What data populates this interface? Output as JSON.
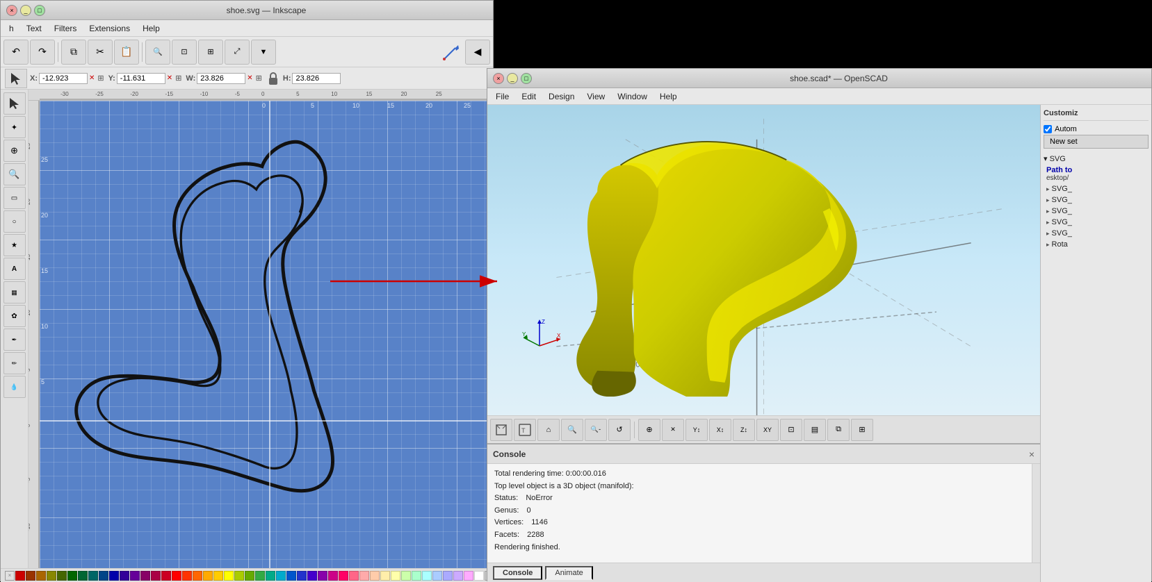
{
  "inkscape": {
    "title": "shoe.svg — Inkscape",
    "menubar": [
      "h",
      "Text",
      "Filters",
      "Extensions",
      "Help"
    ],
    "toolbar_buttons": [
      "undo",
      "redo",
      "copy",
      "cut",
      "paste",
      "zoom-in",
      "zoom-fit",
      "zoom-box",
      "dropdown"
    ],
    "coords": {
      "x_label": "X:",
      "x_value": "-12.923",
      "y_label": "Y:",
      "y_value": "-11.631",
      "w_label": "W:",
      "w_value": "23.826",
      "h_label": "H:",
      "h_value": "23.826"
    },
    "left_toolbar": [
      "select",
      "node",
      "tweak",
      "zoom",
      "rect",
      "circle",
      "star",
      "text",
      "gradient",
      "spray",
      "measure",
      "pen",
      "pencil",
      "bezier",
      "eyedropper"
    ],
    "canvas": {
      "ruler_marks": [
        "-30",
        "-25",
        "-20",
        "-15",
        "-10",
        "-5",
        "0",
        "5",
        "10",
        "15",
        "20",
        "25"
      ],
      "ruler_marks_vertical": [
        "25",
        "20",
        "15",
        "10",
        "5",
        "0",
        "-5",
        "-10"
      ]
    },
    "statusbar": {
      "text": ""
    },
    "colors": [
      "#cc0000",
      "#aa3300",
      "#aa6600",
      "#888800",
      "#446600",
      "#006600",
      "#006633",
      "#006666",
      "#004488",
      "#0000aa",
      "#330099",
      "#660099",
      "#880066",
      "#aa0044",
      "#cc0022",
      "#ff0000",
      "#ff3300",
      "#ff6600",
      "#ffaa00",
      "#ffcc00",
      "#ffff00",
      "#aacc00",
      "#66aa00",
      "#33aa44",
      "#00aa88",
      "#00aacc",
      "#0055cc",
      "#2233cc",
      "#4400cc",
      "#8800aa",
      "#cc0088",
      "#ff0066",
      "#ff6688",
      "#ffaaaa",
      "#ffccaa",
      "#ffeeaa",
      "#ffffaa",
      "#ccffaa",
      "#aaffcc",
      "#aaffff",
      "#aaccff",
      "#aaaaff",
      "#ccaaff",
      "#ffaaff",
      "#ffffff",
      "#cccccc",
      "#aaaaaa",
      "#888888",
      "#555555",
      "#222222",
      "#000000"
    ]
  },
  "openscad": {
    "title": "shoe.scad* — OpenSCAD",
    "menubar": [
      "File",
      "Edit",
      "Design",
      "View",
      "Window",
      "Help"
    ],
    "sidebar": {
      "customize_label": "Customiz",
      "automate_checkbox": "Autom",
      "new_set_button": "New set",
      "svg_section": "▾ SVG",
      "path_label": "Path to",
      "path_value": "esktop/",
      "tree_items": [
        {
          "arrow": "▸",
          "label": "SVG_"
        },
        {
          "arrow": "▸",
          "label": "SVG_"
        },
        {
          "arrow": "▸",
          "label": "SVG_"
        },
        {
          "arrow": "▸",
          "label": "SVG_"
        },
        {
          "arrow": "▸",
          "label": "SVG_"
        },
        {
          "arrow": "▸",
          "label": "Rota"
        }
      ]
    },
    "console": {
      "title": "Console",
      "close_btn": "×",
      "rendering_time": "Total rendering time: 0:00:00.016",
      "top_level": "Top level object is a 3D object (manifold):",
      "status_label": "Status:",
      "status_value": "NoError",
      "genus_label": "Genus:",
      "genus_value": "0",
      "vertices_label": "Vertices:",
      "vertices_value": "1146",
      "facets_label": "Facets:",
      "facets_value": "2288",
      "rendering_done": "Rendering finished.",
      "tab_console": "Console",
      "tab_animate": "Animate"
    },
    "viewport_toolbar": [
      "perspective",
      "top",
      "home",
      "zoom-in-3d",
      "zoom-out-3d",
      "rotate-cw",
      "rotate-x",
      "move-3d",
      "x-cross",
      "y-arrows",
      "x-arrows",
      "z-arrows",
      "xy-plane",
      "xz-plane",
      "yz-plane",
      "section-cut",
      "param1",
      "param2",
      "param3",
      "param4",
      "param5"
    ]
  }
}
